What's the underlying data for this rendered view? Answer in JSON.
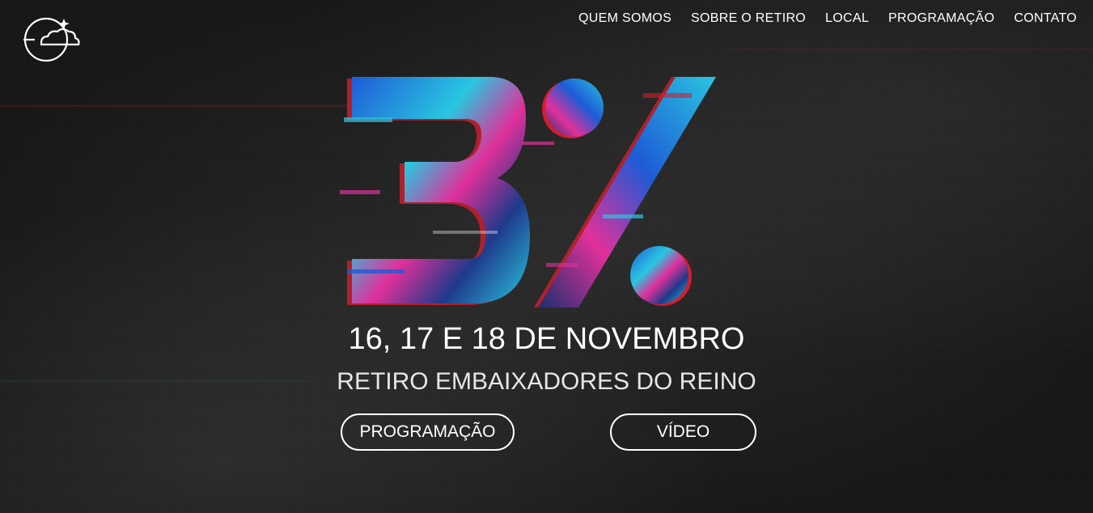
{
  "nav": {
    "items": [
      {
        "label": "QUEM SOMOS"
      },
      {
        "label": "SOBRE O RETIRO"
      },
      {
        "label": "LOCAL"
      },
      {
        "label": "PROGRAMAÇÃO"
      },
      {
        "label": "CONTATO"
      }
    ]
  },
  "logo": {
    "icon": "cloud-moon-star-logo"
  },
  "hero": {
    "artwork_text": "3%",
    "dates": "16, 17 E 18 DE NOVEMBRO",
    "subtitle": "RETIRO EMBAIXADORES DO REINO",
    "buttons": {
      "programacao_label": "PROGRAMAÇÃO",
      "video_label": "VÍDEO"
    }
  },
  "colors": {
    "text": "#ffffff",
    "background": "#1c1c1c",
    "glitch_cyan": "#29c6e0",
    "glitch_magenta": "#e0309a",
    "glitch_blue": "#1e5bd6",
    "glitch_red": "#d41e2a"
  }
}
